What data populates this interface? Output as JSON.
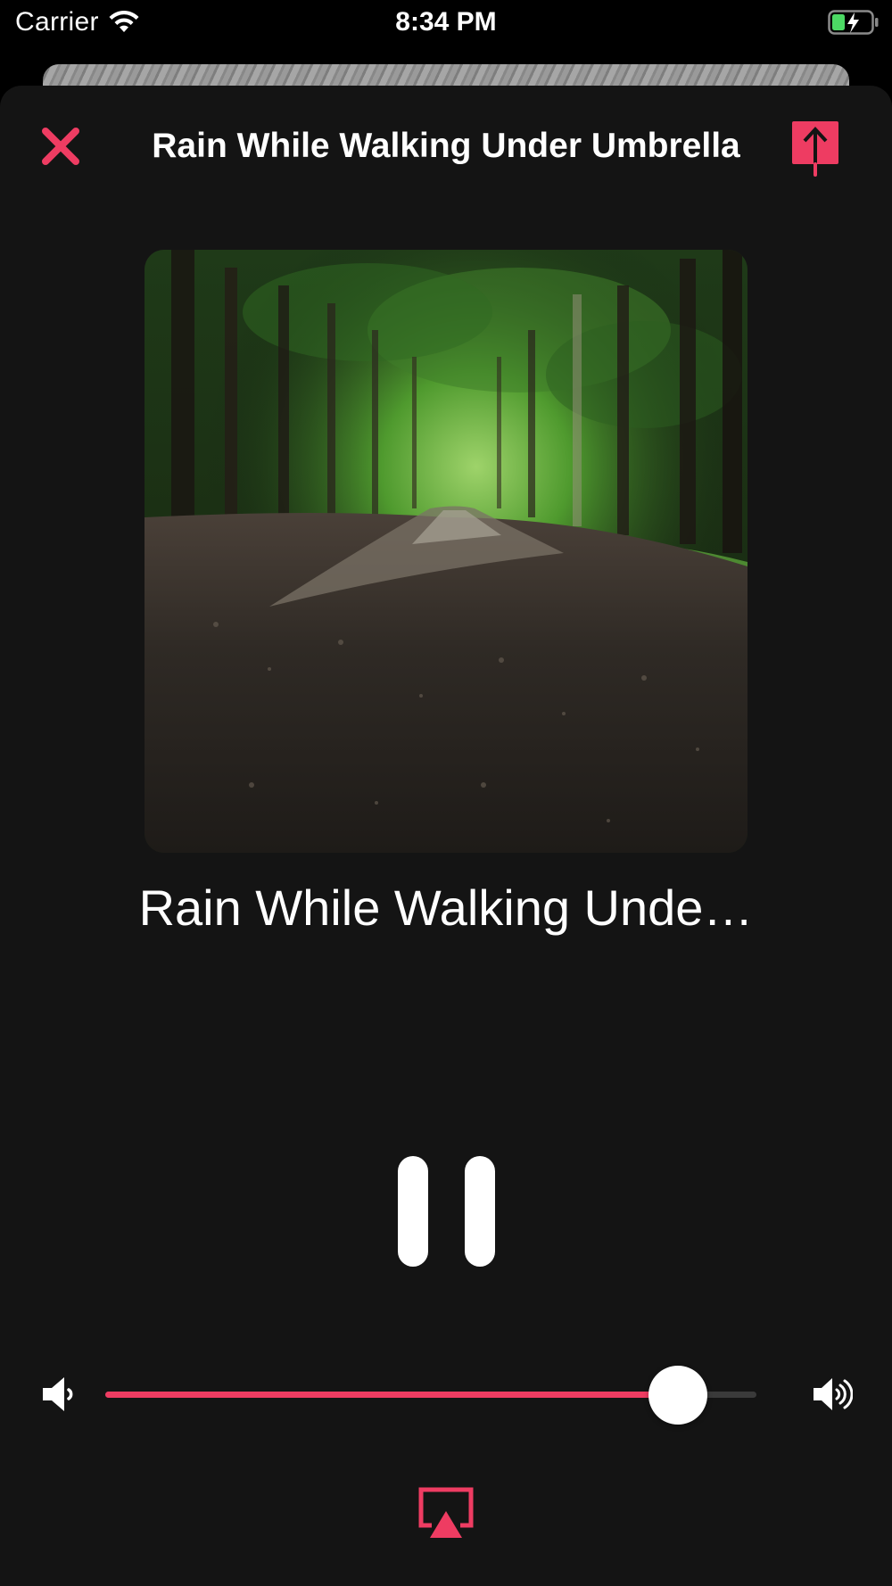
{
  "status_bar": {
    "carrier": "Carrier",
    "time": "8:34 PM",
    "icons": [
      "wifi-icon",
      "battery-charging-icon"
    ]
  },
  "header": {
    "title": "Rain While Walking Under Umbrella",
    "close_icon": "close-icon",
    "share_icon": "share-icon"
  },
  "player": {
    "artwork_description_icon": "artwork-forest-path",
    "track_title": "Rain While Walking Unde…",
    "pause_icon": "pause-icon",
    "volume_level": 0.88,
    "airplay_icon": "airplay-icon"
  },
  "colors": {
    "accent": "#ee3c62",
    "sheet_background": "#141414",
    "text": "#ffffff"
  }
}
